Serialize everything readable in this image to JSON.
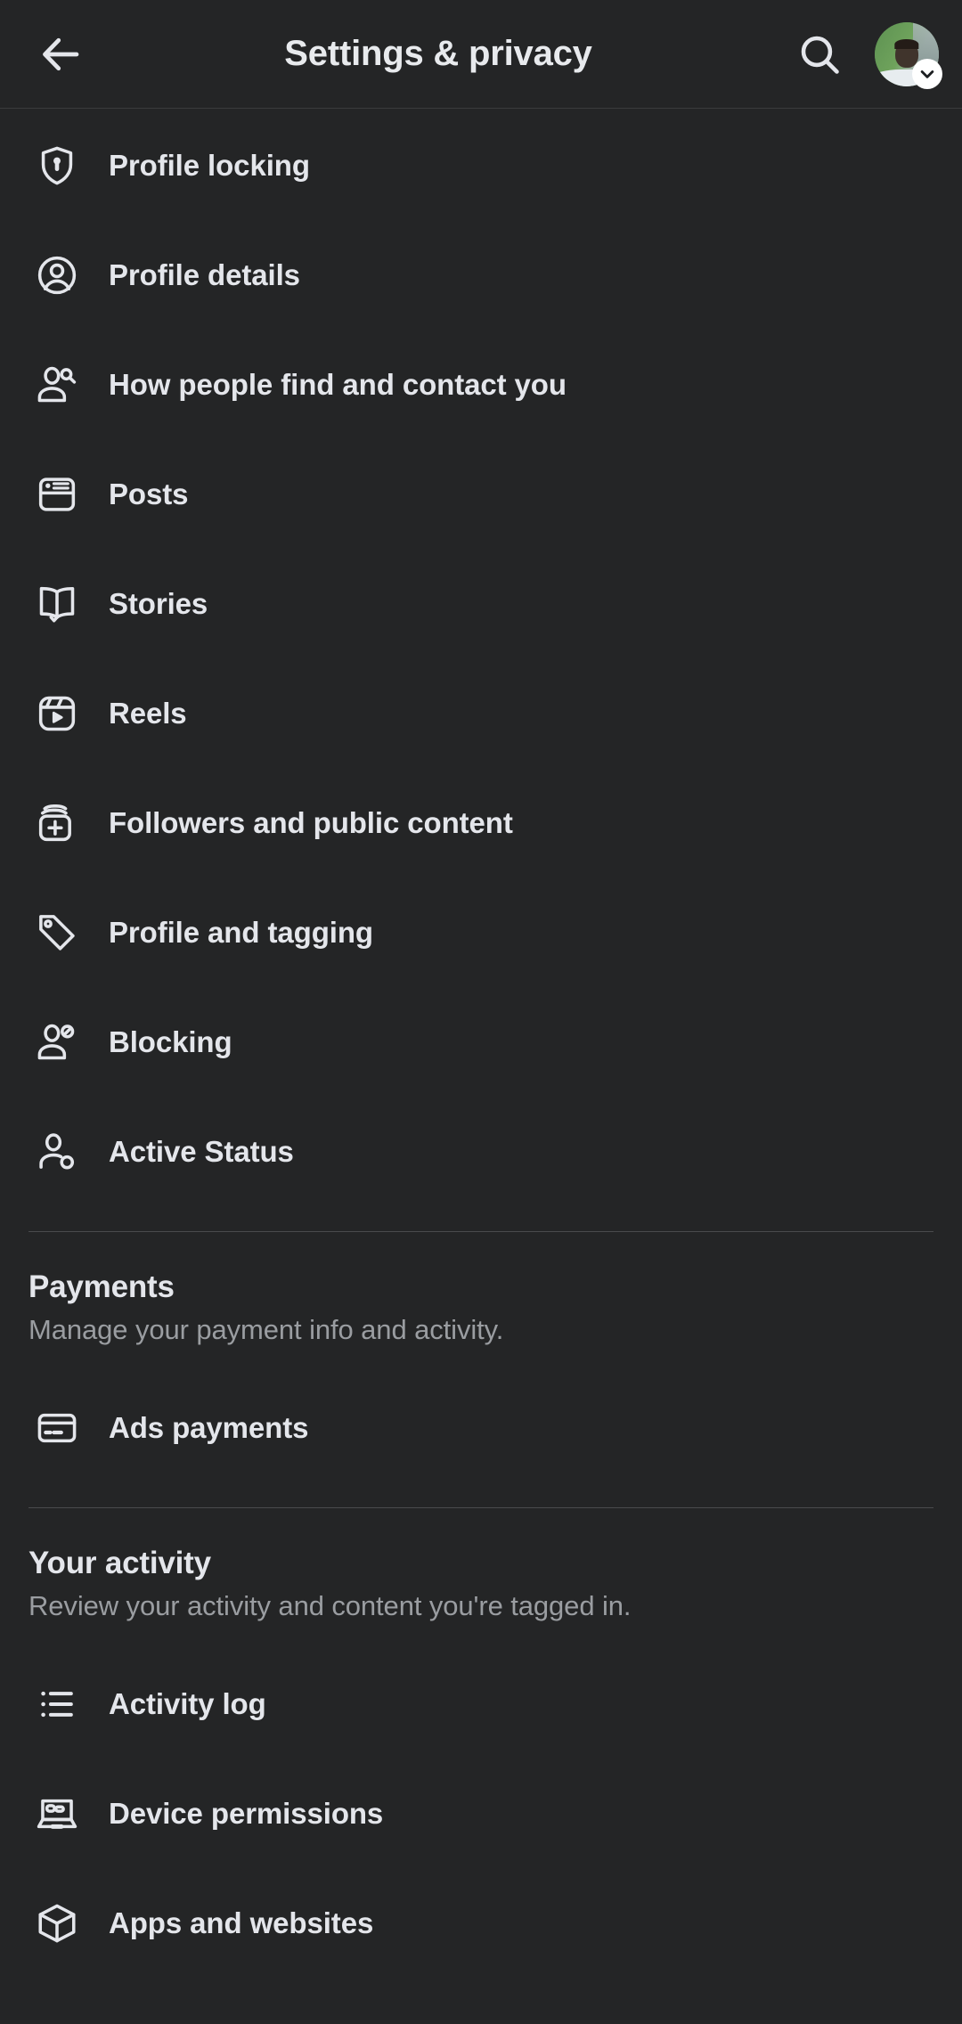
{
  "header": {
    "title": "Settings & privacy",
    "back_icon": "arrow-left-icon",
    "search_icon": "search-icon",
    "avatar_icon": "avatar",
    "avatar_badge_icon": "chevron-down-icon"
  },
  "top_list": [
    {
      "label": "Profile locking",
      "icon": "shield-lock-icon"
    },
    {
      "label": "Profile details",
      "icon": "user-circle-icon"
    },
    {
      "label": "How people find and contact you",
      "icon": "person-search-icon"
    },
    {
      "label": "Posts",
      "icon": "post-card-icon"
    },
    {
      "label": "Stories",
      "icon": "open-book-icon"
    },
    {
      "label": "Reels",
      "icon": "reels-play-icon"
    },
    {
      "label": "Followers and public content",
      "icon": "stacked-card-plus-icon"
    },
    {
      "label": "Profile and tagging",
      "icon": "price-tag-icon"
    },
    {
      "label": "Blocking",
      "icon": "person-block-icon"
    },
    {
      "label": "Active Status",
      "icon": "person-status-icon"
    }
  ],
  "payments": {
    "title": "Payments",
    "subtitle": "Manage your payment info and activity.",
    "items": [
      {
        "label": "Ads payments",
        "icon": "credit-card-icon"
      }
    ]
  },
  "your_activity": {
    "title": "Your activity",
    "subtitle": "Review your activity and content you're tagged in.",
    "items": [
      {
        "label": "Activity log",
        "icon": "list-bullet-icon"
      },
      {
        "label": "Device permissions",
        "icon": "laptop-icon"
      },
      {
        "label": "Apps and websites",
        "icon": "cube-icon"
      }
    ]
  },
  "colors": {
    "background": "#242526",
    "text_primary": "#e4e6eb",
    "text_secondary": "#9a9da1",
    "divider": "#4a4b4d"
  }
}
